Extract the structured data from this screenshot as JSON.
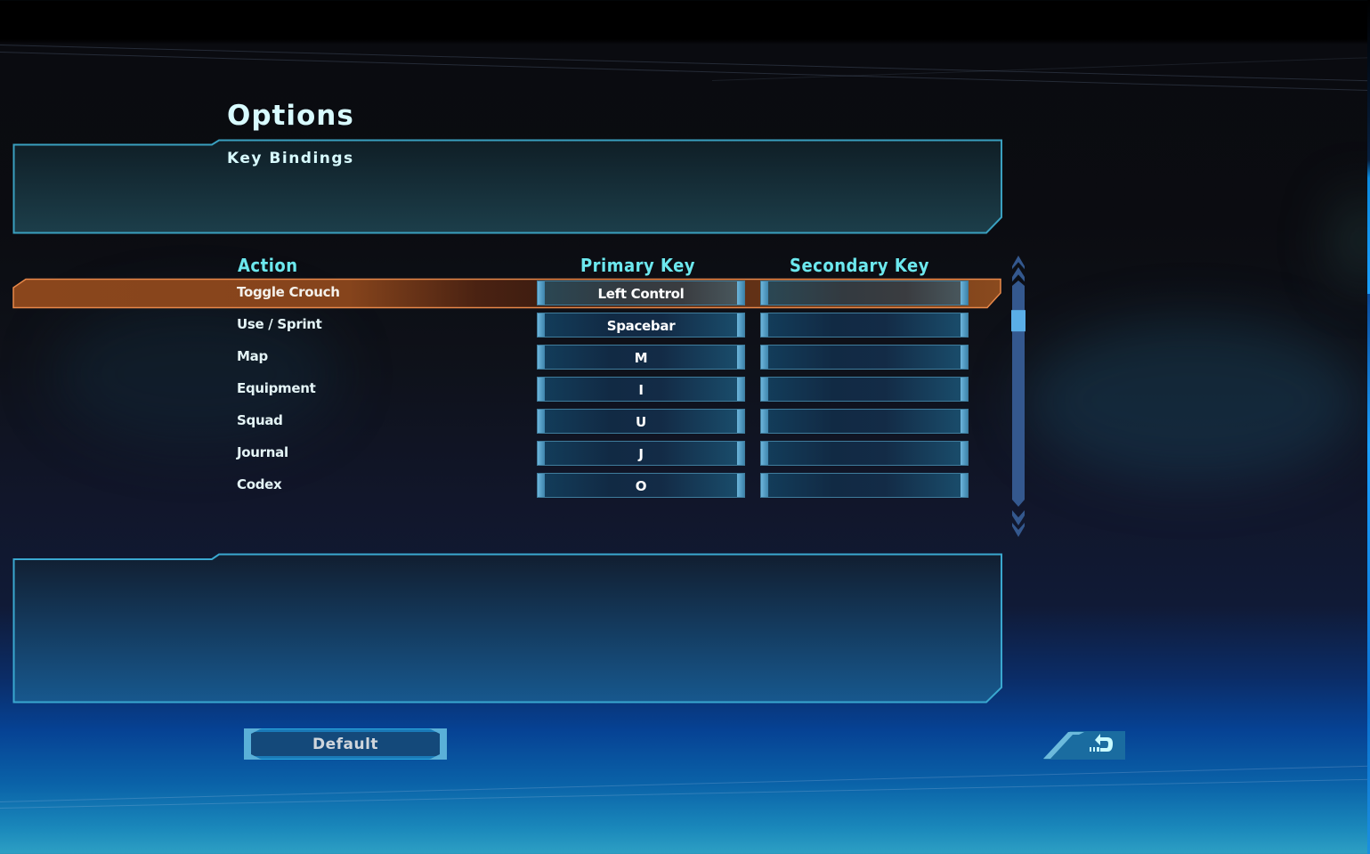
{
  "screen": {
    "title": "Options",
    "subtitle": "Key Bindings"
  },
  "table": {
    "headers": {
      "action": "Action",
      "primary": "Primary Key",
      "secondary": "Secondary Key"
    },
    "rows": [
      {
        "action": "Toggle Crouch",
        "primary": "Left Control",
        "secondary": "",
        "selected": true
      },
      {
        "action": "Use / Sprint",
        "primary": "Spacebar",
        "secondary": ""
      },
      {
        "action": "Map",
        "primary": "M",
        "secondary": ""
      },
      {
        "action": "Equipment",
        "primary": "I",
        "secondary": ""
      },
      {
        "action": "Squad",
        "primary": "U",
        "secondary": ""
      },
      {
        "action": "Journal",
        "primary": "J",
        "secondary": ""
      },
      {
        "action": "Codex",
        "primary": "O",
        "secondary": ""
      }
    ]
  },
  "scrollbar": {
    "thumb_position_fraction": 0.12,
    "up_icon": "double-chevron-up-icon",
    "down_icon": "double-chevron-down-icon"
  },
  "buttons": {
    "default_label": "Default",
    "back_icon": "back-arrow-icon"
  },
  "colors": {
    "accent_cyan": "#6ce8ee",
    "title_text": "#d8fbff",
    "panel_border": "#3aa0c0",
    "selection_orange": "#8a4a1e",
    "selection_border": "#e8884a",
    "key_box_edge": "#6db6dc",
    "scrollbar_track": "#34588e",
    "scrollbar_thumb": "#5aaee6"
  }
}
